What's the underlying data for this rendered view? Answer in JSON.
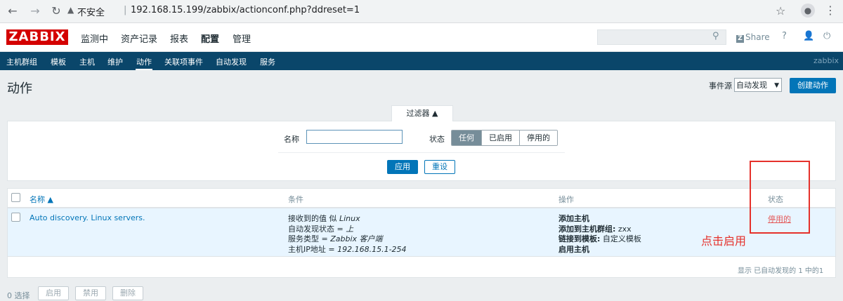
{
  "browser": {
    "security_label": "不安全",
    "url": "192.168.15.199/zabbix/actionconf.php?ddreset=1"
  },
  "header": {
    "logo": "ZABBIX",
    "menu": [
      "监测中",
      "资产记录",
      "报表",
      "配置",
      "管理"
    ],
    "share_label": "Share",
    "help_label": "?"
  },
  "subnav": {
    "items": [
      "主机群组",
      "模板",
      "主机",
      "维护",
      "动作",
      "关联项事件",
      "自动发现",
      "服务"
    ],
    "brand": "zabbix"
  },
  "page": {
    "title": "动作",
    "event_source_label": "事件源",
    "event_source_value": "自动发现",
    "create_button": "创建动作"
  },
  "filter": {
    "tab_label": "过滤器 ▲",
    "name_label": "名称",
    "name_value": "",
    "status_label": "状态",
    "status_options": [
      "任何",
      "已启用",
      "停用的"
    ],
    "apply_label": "应用",
    "reset_label": "重设"
  },
  "table": {
    "headers": {
      "name": "名称 ▲",
      "conditions": "条件",
      "operations": "操作",
      "status": "状态"
    },
    "rows": [
      {
        "name": "Auto discovery. Linux servers.",
        "conditions": [
          {
            "prefix": "接收到的值 似 ",
            "value": "Linux"
          },
          {
            "prefix": "自动发现状态 = ",
            "value": "上"
          },
          {
            "prefix": "服务类型 = ",
            "value": "Zabbix 客户端"
          },
          {
            "prefix": "主机IP地址 = ",
            "value": "192.168.15.1-254"
          }
        ],
        "operations": [
          {
            "bold": "添加主机",
            "rest": ""
          },
          {
            "bold": "添加到主机群组:",
            "rest": " zxx"
          },
          {
            "bold": "链接到模板:",
            "rest": " 自定义模板"
          },
          {
            "bold": "启用主机",
            "rest": ""
          }
        ],
        "status": "停用的"
      }
    ],
    "summary": "显示 已自动发现的 1 中的1"
  },
  "annotation": {
    "text": "点击启用",
    "color": "#e5312b"
  },
  "footer": {
    "selected": "0 选择",
    "buttons": [
      "启用",
      "禁用",
      "删除"
    ]
  },
  "colors": {
    "brand_red": "#d40000",
    "nav_blue": "#0a466a",
    "primary": "#0275b8",
    "disabled_red": "#e45959"
  }
}
